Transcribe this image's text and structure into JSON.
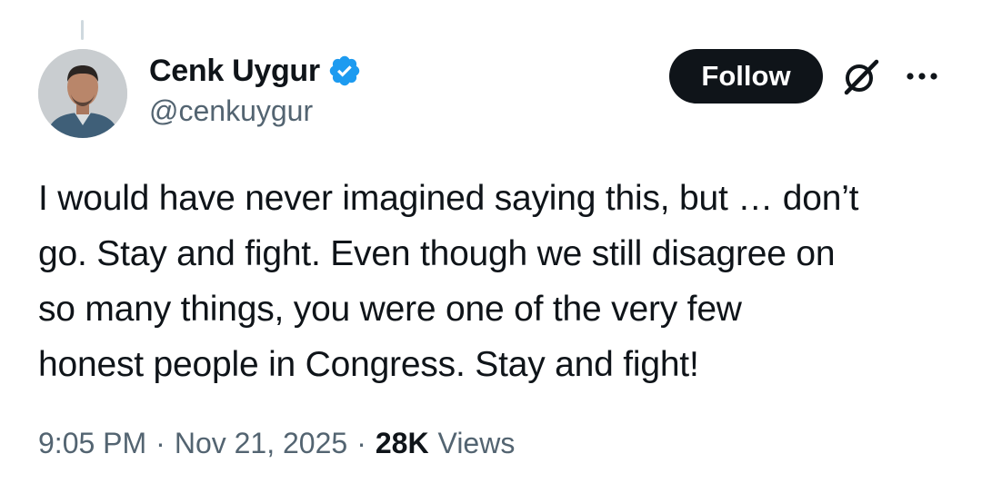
{
  "author": {
    "display_name": "Cenk Uygur",
    "handle": "@cenkuygur",
    "verified": true,
    "verified_color": "#1d9bf0"
  },
  "actions": {
    "follow_label": "Follow",
    "grok_icon": "grok-icon",
    "more_icon": "more-icon"
  },
  "tweet": {
    "text_lines": [
      "I would have never imagined saying this, but … don’t",
      "go. Stay and fight. Even though we still disagree on",
      "so many things, you were one of the very few",
      "honest people in Congress. Stay and fight!"
    ],
    "time": "9:05 PM",
    "separator": "·",
    "date": "Nov 21, 2025",
    "views_count": "28K",
    "views_label": "Views"
  }
}
